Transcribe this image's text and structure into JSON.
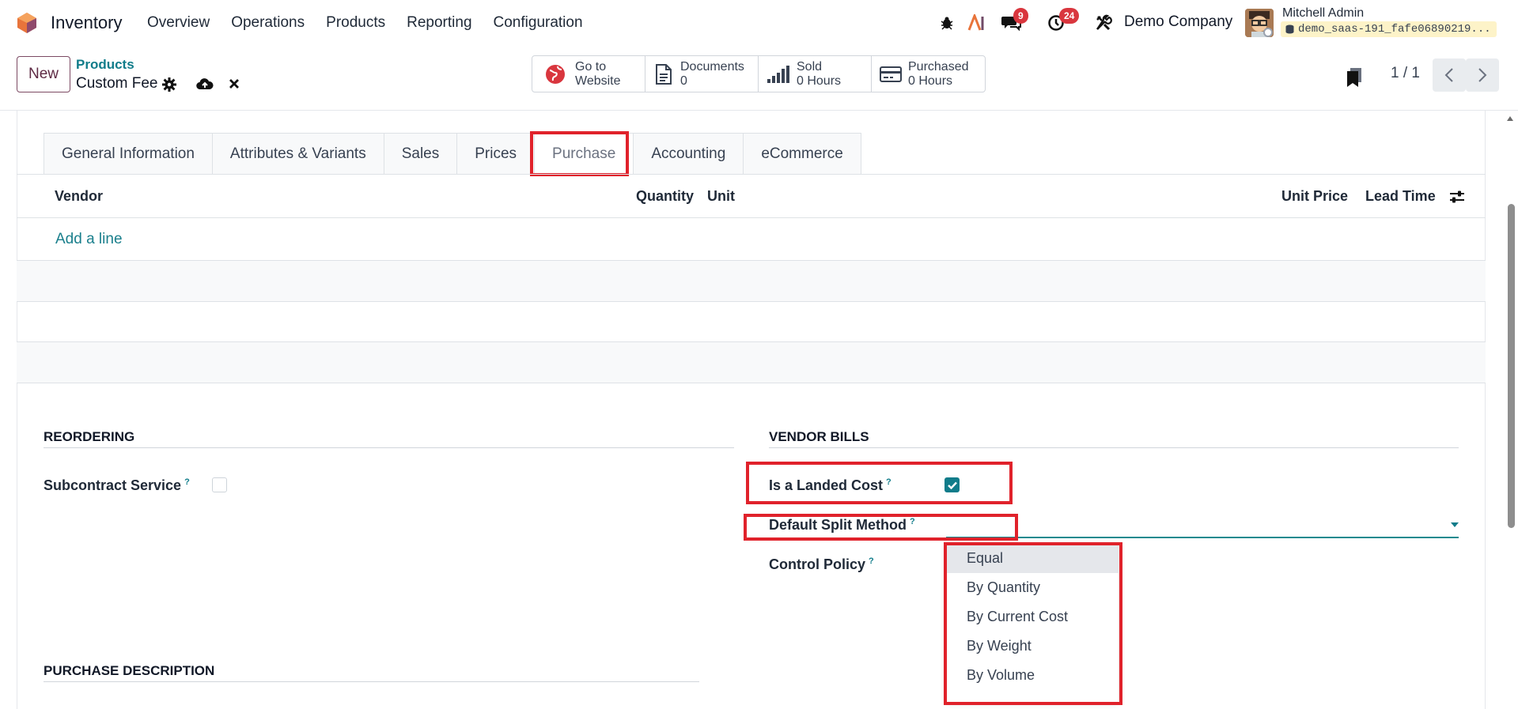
{
  "app": {
    "name": "Inventory"
  },
  "menu": [
    "Overview",
    "Operations",
    "Products",
    "Reporting",
    "Configuration"
  ],
  "systray": {
    "messages_count": "9",
    "activities_count": "24",
    "company": "Demo Company",
    "user_name": "Mitchell Admin",
    "database": "demo_saas-191_fafe06890219..."
  },
  "control": {
    "new_label": "New",
    "breadcrumb_parent": "Products",
    "record_title": "Custom Fee",
    "smart_buttons": [
      {
        "line1": "Go to",
        "line2": "Website"
      },
      {
        "line1": "Documents",
        "line2": "0"
      },
      {
        "line1": "Sold",
        "line2": "0 Hours"
      },
      {
        "line1": "Purchased",
        "line2": "0 Hours"
      }
    ],
    "pager": "1 / 1"
  },
  "tabs": [
    "General Information",
    "Attributes & Variants",
    "Sales",
    "Prices",
    "Purchase",
    "Accounting",
    "eCommerce"
  ],
  "active_tab": "Purchase",
  "vendor_table": {
    "headers": {
      "vendor": "Vendor",
      "quantity": "Quantity",
      "unit": "Unit",
      "unit_price": "Unit Price",
      "lead_time": "Lead Time"
    },
    "add_line": "Add a line"
  },
  "reordering": {
    "title": "REORDERING",
    "subcontract_label": "Subcontract Service",
    "subcontract_checked": false
  },
  "vendor_bills": {
    "title": "VENDOR BILLS",
    "landed_cost_label": "Is a Landed Cost",
    "landed_cost_checked": true,
    "split_method_label": "Default Split Method",
    "control_policy_label": "Control Policy"
  },
  "split_options": [
    "Equal",
    "By Quantity",
    "By Current Cost",
    "By Weight",
    "By Volume"
  ],
  "purchase_description": {
    "title": "PURCHASE DESCRIPTION"
  },
  "tooltip_mark": "?",
  "colors": {
    "accent": "#107c8a",
    "highlight": "#e0222b",
    "brand": "#714b67",
    "badge": "#d9363e"
  }
}
